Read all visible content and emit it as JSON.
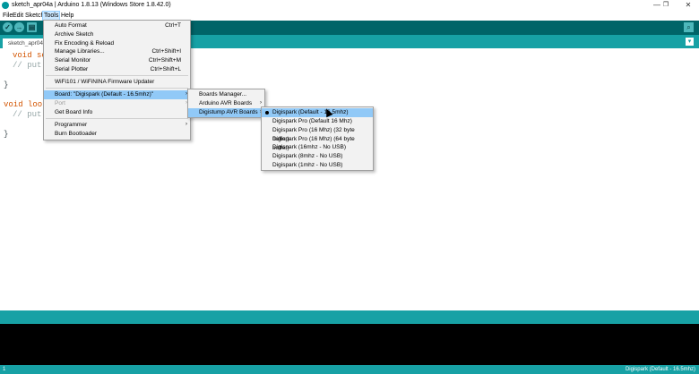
{
  "window": {
    "title": "sketch_apr04a | Arduino 1.8.13 (Windows Store 1.8.42.0)",
    "minimize": "—",
    "maximize": "❐",
    "close": "✕"
  },
  "menubar": {
    "file": "File",
    "edit": "Edit",
    "sketch": "Sketch",
    "tools": "Tools",
    "help": "Help"
  },
  "toolbar": {
    "verify": "✓",
    "upload": "→",
    "new": "▤",
    "serial_monitor": "⌕"
  },
  "tab": {
    "name": "sketch_apr04a",
    "menu_arrow": "▾"
  },
  "code": {
    "setup_kw": "void se",
    "setup_comment": "// put",
    "setup_close": "}",
    "loop_kw": "void loop",
    "loop_comment": "// put",
    "loop_close": "}"
  },
  "tools_menu": {
    "auto_format": "Auto Format",
    "auto_format_sc": "Ctrl+T",
    "archive_sketch": "Archive Sketch",
    "fix_encoding": "Fix Encoding & Reload",
    "manage_libraries": "Manage Libraries...",
    "manage_libraries_sc": "Ctrl+Shift+I",
    "serial_monitor": "Serial Monitor",
    "serial_monitor_sc": "Ctrl+Shift+M",
    "serial_plotter": "Serial Plotter",
    "serial_plotter_sc": "Ctrl+Shift+L",
    "wifi_updater": "WiFi101 / WiFiNINA Firmware Updater",
    "board": "Board: \"Digispark (Default - 16.5mhz)\"",
    "port": "Port",
    "board_info": "Get Board Info",
    "programmer": "Programmer",
    "burn_bootloader": "Burn Bootloader",
    "submenu_arrow": "›"
  },
  "board_menu": {
    "boards_manager": "Boards Manager...",
    "arduino_avr": "Arduino AVR Boards",
    "digistump_avr": "Digistump AVR Boards"
  },
  "digistump_menu": {
    "items": [
      "Digispark (Default - 16.5mhz)",
      "Digispark Pro (Default 16 Mhz)",
      "Digispark Pro (16 Mhz) (32 byte buffer)",
      "Digispark Pro (16 Mhz) (64 byte buffer)",
      "Digispark (16mhz - No USB)",
      "Digispark (8mhz - No USB)",
      "Digispark (1mhz - No USB)"
    ],
    "selected_index": 0
  },
  "status": {
    "line": "1",
    "board": "Digispark (Default - 16.5mhz)"
  },
  "colors": {
    "toolbar": "#006468",
    "tabbar": "#17a1a5",
    "highlight": "#91c9f7"
  }
}
